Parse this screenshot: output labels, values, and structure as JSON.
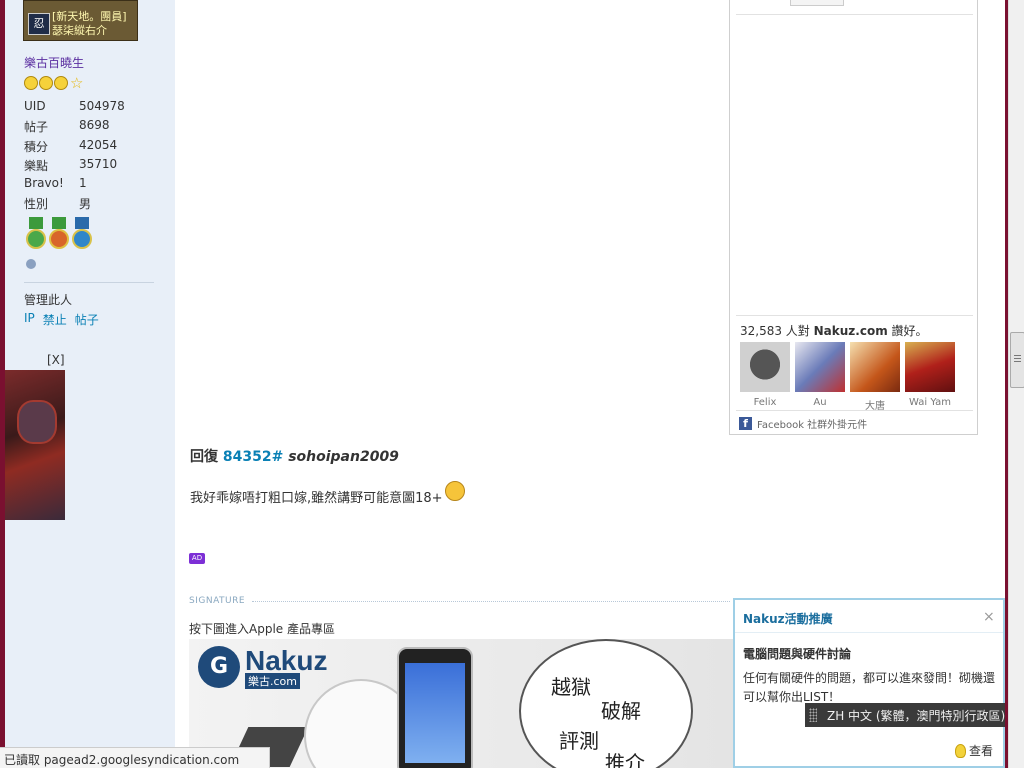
{
  "sidebar": {
    "rank_badge_lines": [
      "[新天地。團員]",
      "瑟柒縱右介"
    ],
    "rank_logo": "忍",
    "rank_title": "樂古百曉生",
    "stats": [
      {
        "label": "UID",
        "value": "504978"
      },
      {
        "label": "帖子",
        "value": "8698"
      },
      {
        "label": "積分",
        "value": "42054"
      },
      {
        "label": "樂點",
        "value": "35710"
      },
      {
        "label": "Bravo!",
        "value": "1"
      },
      {
        "label": "性別",
        "value": "男"
      }
    ],
    "manage_title": "管理此人",
    "manage_links": [
      "IP",
      "禁止",
      "帖子"
    ],
    "ad_close": "[X]"
  },
  "facebook": {
    "count_prefix": "32,583 人對 ",
    "site": "Nakuz.com",
    "count_suffix": " 讚好。",
    "fans": [
      {
        "name": "Felix",
        "color": "#444444"
      },
      {
        "name": "Au",
        "color": "#6a7bb8"
      },
      {
        "name": "大唐",
        "color": "#c4561a"
      },
      {
        "name": "Wai Yam",
        "color": "#b0201a"
      }
    ],
    "footer": "Facebook 社群外掛元件"
  },
  "post": {
    "reply_label": "回復",
    "post_number": "84352#",
    "username": "sohoipan2009",
    "body": "我好乖嫁唔打粗口嫁,雖然講野可能意圖18+",
    "ad_tag": "AD"
  },
  "signature": {
    "label": "SIGNATURE",
    "text": "按下圖進入Apple 產品專區",
    "banner": {
      "brand": "Nakuz",
      "sub": "樂古.com",
      "words": [
        "越獄",
        "破解",
        "評測",
        "推介"
      ]
    }
  },
  "popup": {
    "title": "Nakuz活動推廣",
    "close": "×",
    "subtitle": "電腦問題與硬件討論",
    "body": "任何有關硬件的問題，都可以進來發問！砌機還可以幫你出LIST！",
    "more": "查看"
  },
  "language_bar": {
    "text": "ZH 中文 (繁體，澳門特別行政區)"
  },
  "status_bar": {
    "text": "已讀取 pagead2.googlesyndication.com"
  }
}
